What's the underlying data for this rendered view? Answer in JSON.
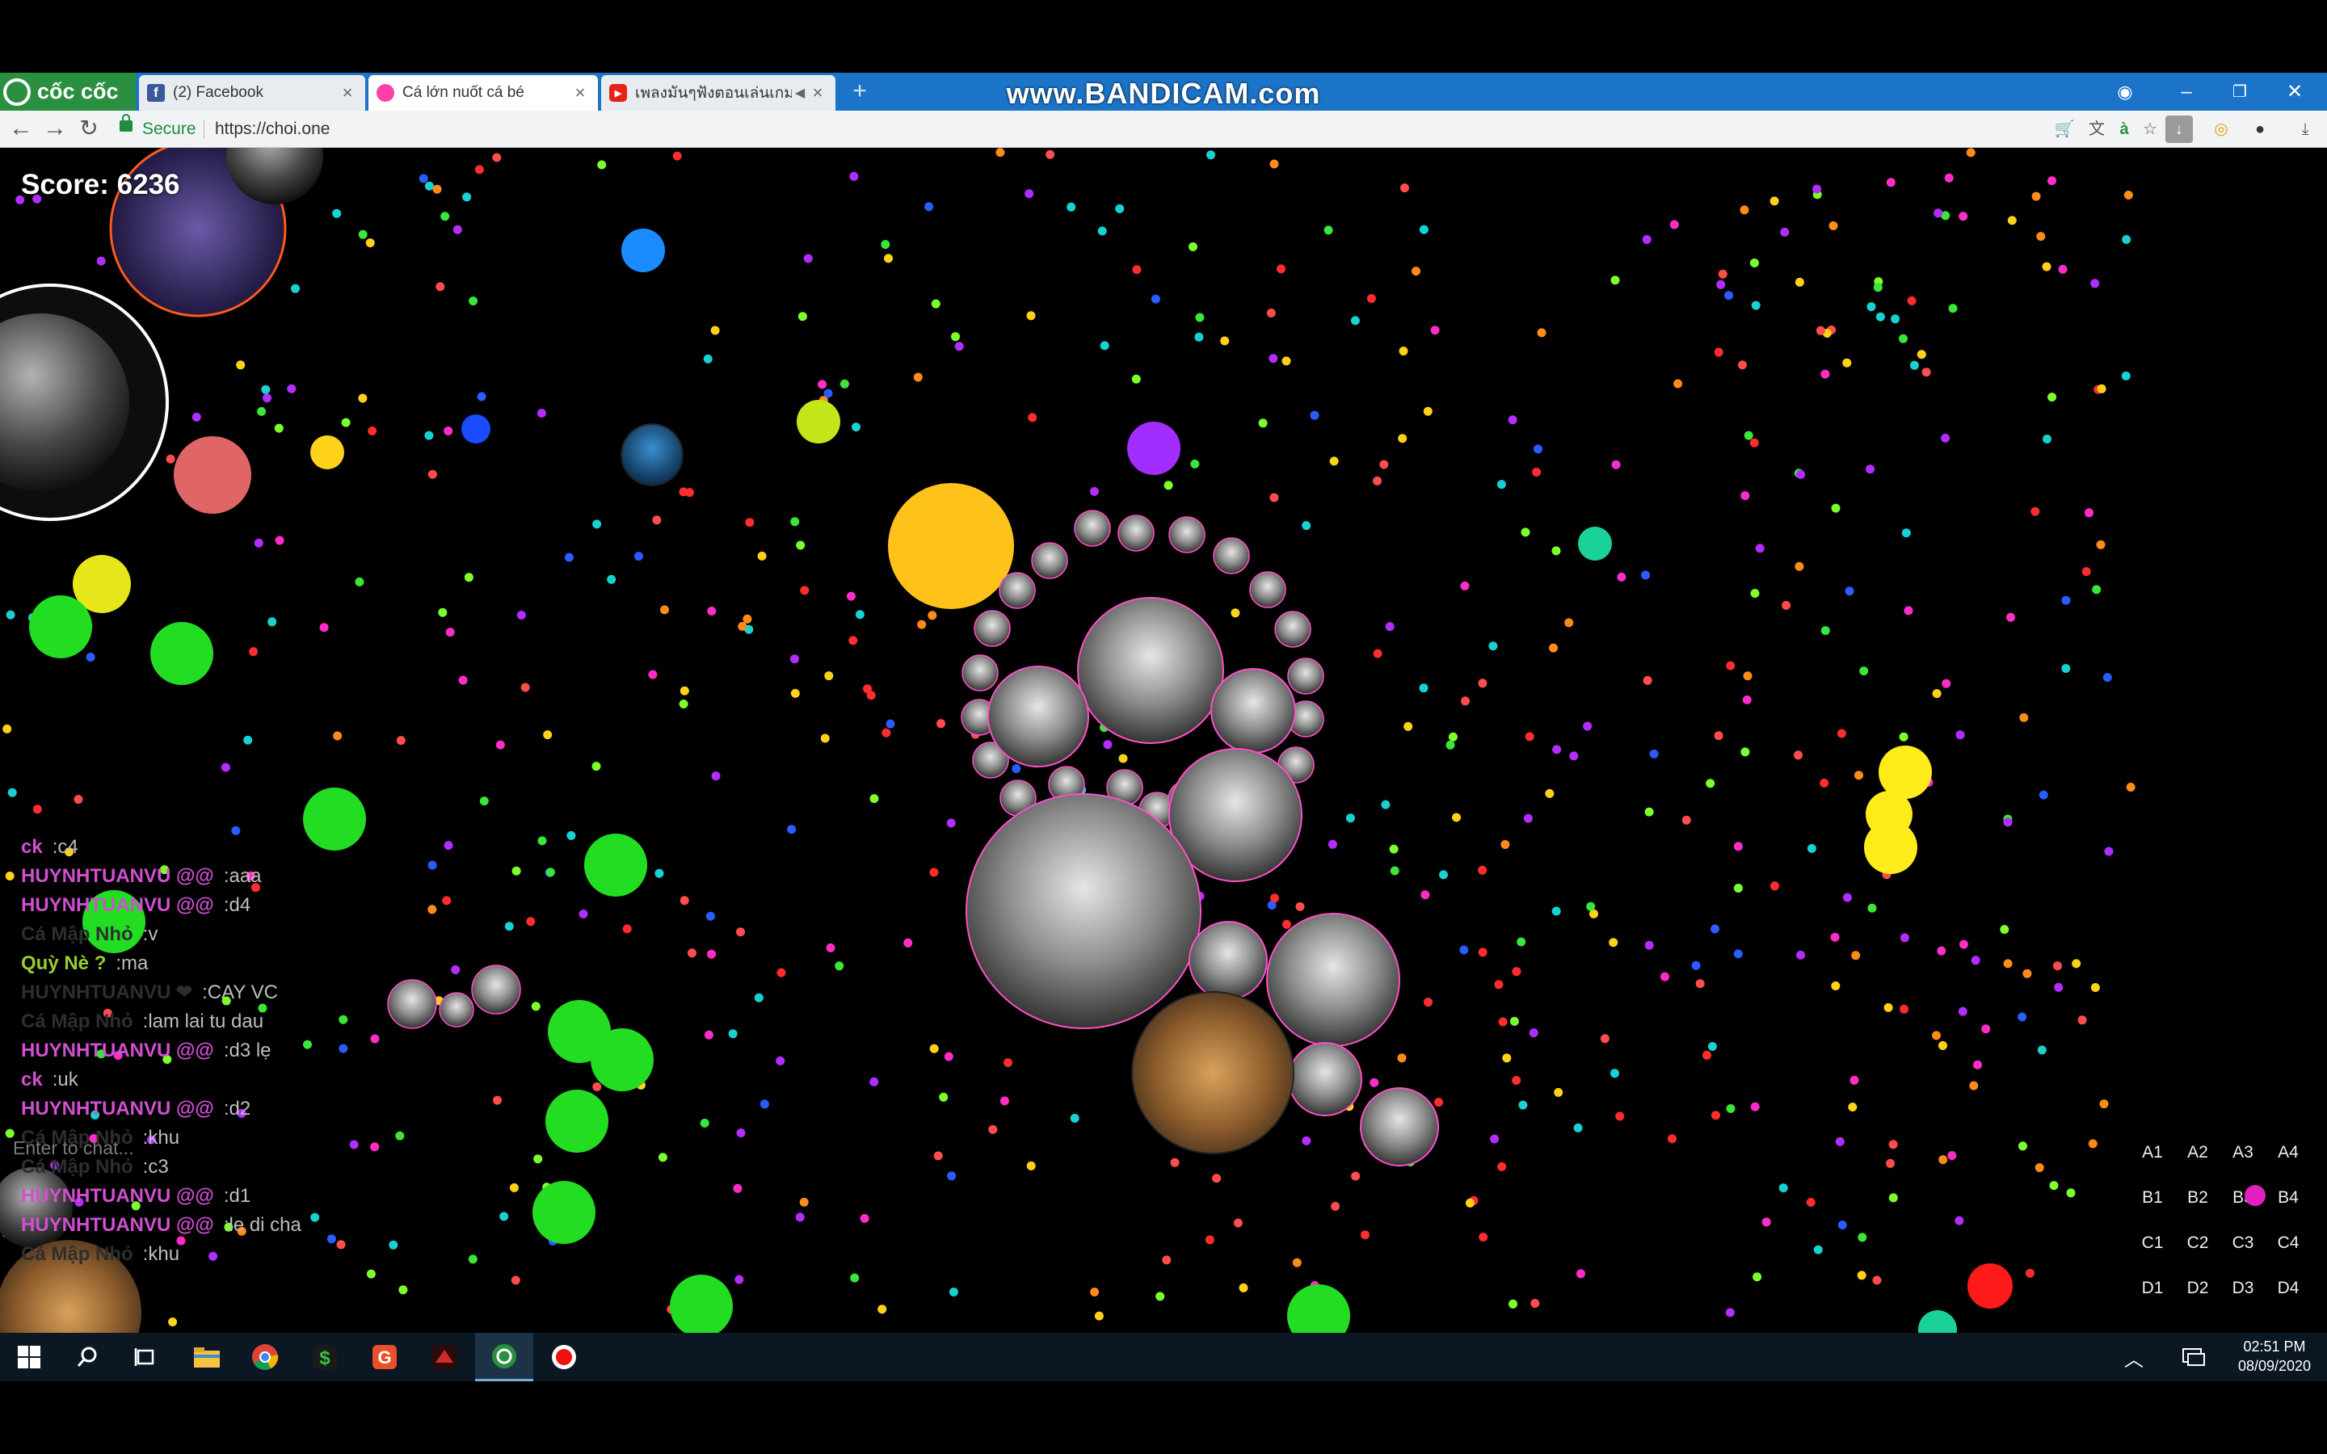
{
  "browser": {
    "brand": "cốc cốc",
    "tabs": [
      {
        "label": "(2) Facebook",
        "icon": "facebook-icon",
        "color": "#3b5998",
        "active": false
      },
      {
        "label": "Cá lớn nuốt cá bé",
        "icon": "game-favicon-icon",
        "color": "#ff3fa8",
        "active": true
      },
      {
        "label": "เพลงมันๆฟังตอนเล่นเกมก๊",
        "icon": "youtube-icon",
        "color": "#e62117",
        "active": false
      }
    ],
    "new_tab": "+",
    "watermark": "www.BANDICAM.com",
    "secure_label": "Secure",
    "url": "https://choi.one"
  },
  "game": {
    "score_label": "Score: 6236",
    "chat": [
      {
        "name": "ck",
        "msg": ":c4",
        "color": "#d14fd1"
      },
      {
        "name": "HUYNHTUANVU @@",
        "msg": ":aaa",
        "color": "#d14fd1"
      },
      {
        "name": "HUYNHTUANVU @@",
        "msg": ":d4",
        "color": "#d14fd1"
      },
      {
        "name": "Cá Mập Nhỏ",
        "msg": ":v",
        "color": "#2e2e2e"
      },
      {
        "name": "Quỳ Nè ?",
        "msg": ":ma",
        "color": "#9acd32"
      },
      {
        "name": "HUYNHTUANVU ❤",
        "msg": ":CAY VC",
        "color": "#2e2e2e"
      },
      {
        "name": "Cá Mập Nhỏ",
        "msg": ":lam lai tu dau",
        "color": "#2e2e2e"
      },
      {
        "name": "HUYNHTUANVU @@",
        "msg": ":d3 lẹ",
        "color": "#d14fd1"
      },
      {
        "name": "ck",
        "msg": ":uk",
        "color": "#d14fd1"
      },
      {
        "name": "HUYNHTUANVU @@",
        "msg": ":d2",
        "color": "#d14fd1"
      },
      {
        "name": "Cá Mập Nhỏ",
        "msg": ":khu",
        "color": "#2e2e2e"
      },
      {
        "name": "Cá Mập Nhỏ",
        "msg": ":c3",
        "color": "#2e2e2e"
      },
      {
        "name": "HUYNHTUANVU @@",
        "msg": ":d1",
        "color": "#d14fd1"
      },
      {
        "name": "HUYNHTUANVU @@",
        "msg": ":le di cha",
        "color": "#d14fd1"
      },
      {
        "name": "Cá Mập Nhỏ",
        "msg": ":khu",
        "color": "#2e2e2e"
      }
    ],
    "chat_placeholder": "Enter to chat...",
    "minimap": [
      [
        "A1",
        "A2",
        "A3",
        "A4"
      ],
      [
        "B1",
        "B2",
        "B3",
        "B4"
      ],
      [
        "C1",
        "C2",
        "C3",
        "C4"
      ],
      [
        "D1",
        "D2",
        "D3",
        "D4"
      ]
    ],
    "player_sector": "B3"
  },
  "taskbar": {
    "time": "02:51 PM",
    "date": "08/09/2020"
  }
}
